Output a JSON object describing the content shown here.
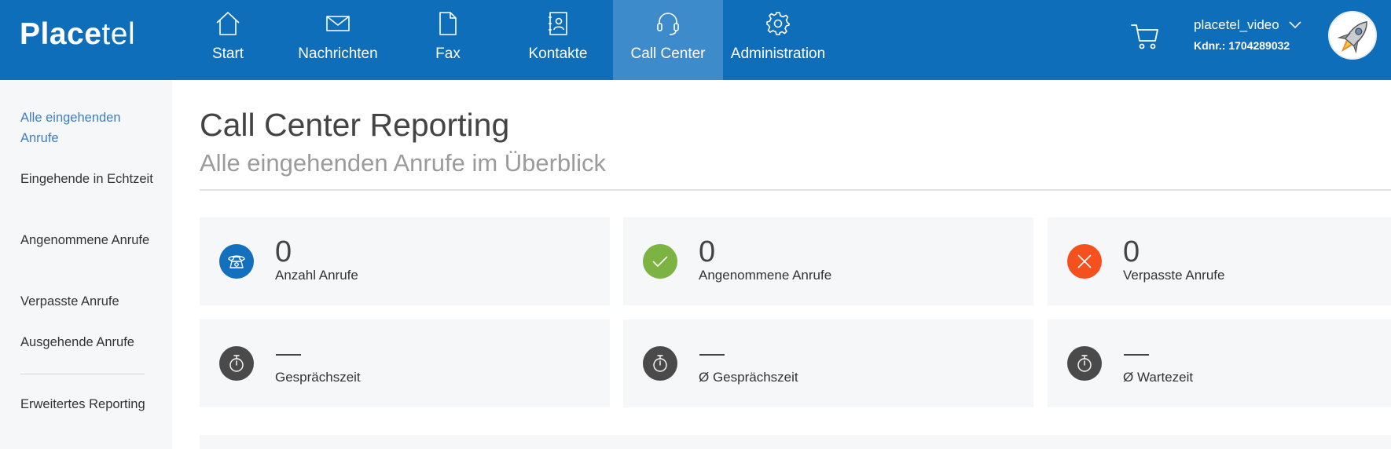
{
  "header": {
    "logo_bold": "Place",
    "logo_thin": "tel",
    "nav": [
      {
        "label": "Start",
        "icon": "home-icon",
        "active": false
      },
      {
        "label": "Nachrichten",
        "icon": "mail-icon",
        "active": false
      },
      {
        "label": "Fax",
        "icon": "fax-document-icon",
        "active": false
      },
      {
        "label": "Kontakte",
        "icon": "contacts-book-icon",
        "active": false
      },
      {
        "label": "Call Center",
        "icon": "headset-icon",
        "active": true
      },
      {
        "label": "Administration",
        "icon": "gear-icon",
        "active": false
      }
    ],
    "user_name": "placetel_video",
    "customer_number": "Kdnr.: 1704289032"
  },
  "sidebar": {
    "items": [
      {
        "label": "Alle eingehenden Anrufe",
        "active": true
      },
      {
        "label": "Eingehende in Echtzeit",
        "active": false
      },
      {
        "label": "Angenommene Anrufe",
        "active": false
      },
      {
        "label": "Verpasste Anrufe",
        "active": false
      },
      {
        "label": "Ausgehende Anrufe",
        "active": false
      },
      {
        "label": "Erweitertes Reporting",
        "active": false
      }
    ]
  },
  "main": {
    "title": "Call Center Reporting",
    "subtitle": "Alle eingehenden Anrufe im Überblick",
    "stats": [
      {
        "value": "0",
        "label": "Anzahl Anrufe",
        "icon": "phone-icon",
        "color": "#1470bd"
      },
      {
        "value": "0",
        "label": "Angenommene Anrufe",
        "icon": "checkmark-icon",
        "color": "#7cb342"
      },
      {
        "value": "0",
        "label": "Verpasste Anrufe",
        "icon": "close-icon",
        "color": "#f4511e"
      },
      {
        "value": "",
        "label": "Gesprächszeit",
        "icon": "stopwatch-icon",
        "color": "#4a4a4a"
      },
      {
        "value": "",
        "label": "Ø Gesprächszeit",
        "icon": "stopwatch-icon",
        "color": "#4a4a4a"
      },
      {
        "value": "",
        "label": "Ø Wartezeit",
        "icon": "stopwatch-icon",
        "color": "#4a4a4a"
      }
    ]
  },
  "colors": {
    "brand": "#0f6eb9",
    "nav_active": "#3e8bcb",
    "sidebar_active": "#3d7fc0"
  }
}
